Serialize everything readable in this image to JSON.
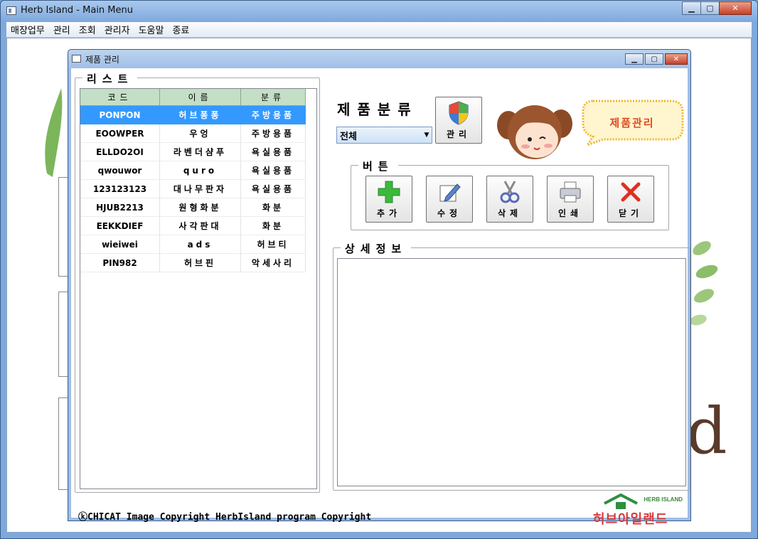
{
  "main_window": {
    "title": "Herb Island - Main Menu",
    "controls": {
      "minimize": "▁",
      "maximize": "▢",
      "close": "✕"
    }
  },
  "menu": [
    "매장업무",
    "관리",
    "조회",
    "관리자",
    "도움말",
    "종료"
  ],
  "background": {
    "letter": "d"
  },
  "product_window": {
    "title": "제품 관리",
    "controls": {
      "minimize": "▁",
      "maximize": "▢",
      "close": "✕"
    }
  },
  "list_group": {
    "label": "리스트",
    "columns": [
      "코드",
      "이름",
      "분류"
    ],
    "rows": [
      {
        "code": "PONPON",
        "name": "허브퐁퐁",
        "category": "주방용품",
        "selected": true
      },
      {
        "code": "EOOWPER",
        "name": "우엉",
        "category": "주방용품"
      },
      {
        "code": "ELLDO2OI",
        "name": "라벤더샴푸",
        "category": "욕실용품"
      },
      {
        "code": "qwouwor",
        "name": "quro",
        "category": "욕실용품"
      },
      {
        "code": "123123123",
        "name": "대나무판자",
        "category": "욕실용품"
      },
      {
        "code": "HJUB2213",
        "name": "원형화분",
        "category": "화분"
      },
      {
        "code": "EEKKDIEF",
        "name": "사각판대",
        "category": "화분"
      },
      {
        "code": "wieiwei",
        "name": "ads",
        "category": "허브티"
      },
      {
        "code": "PIN982",
        "name": "허브핀",
        "category": "악세사리"
      }
    ]
  },
  "category": {
    "label": "제품분류",
    "selected": "전체",
    "manage_label": "관리"
  },
  "speech_bubble": "제품관리",
  "button_group": {
    "label": "버튼",
    "buttons": [
      {
        "label": "추가",
        "icon": "plus-icon"
      },
      {
        "label": "수정",
        "icon": "pencil-icon"
      },
      {
        "label": "삭제",
        "icon": "scissors-icon"
      },
      {
        "label": "인쇄",
        "icon": "printer-icon"
      },
      {
        "label": "닫기",
        "icon": "x-icon"
      }
    ]
  },
  "detail_group": {
    "label": "상세정보",
    "content": ""
  },
  "footer": {
    "copyright": "ⓚCHICAT Image Copyright HerbIsland program Copyright",
    "logo_small": "HERB ISLAND",
    "logo_main": "허브아일랜드"
  }
}
